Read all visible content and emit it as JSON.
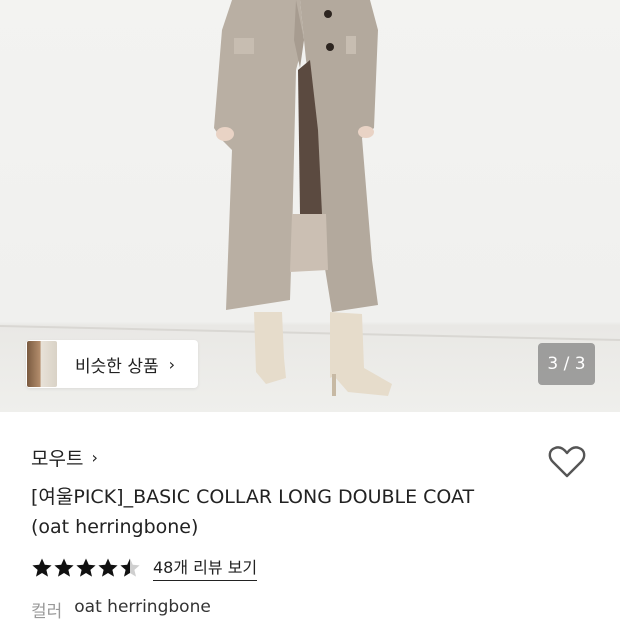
{
  "hero": {
    "similar_products_label": "비슷한 상품",
    "similar_chevron": "›",
    "image_counter": "3 / 3"
  },
  "product": {
    "brand": "모우트",
    "brand_chevron": "›",
    "title_line1": "[여울PICK]_BASIC COLLAR LONG DOUBLE COAT",
    "title_line2": "(oat herringbone)",
    "rating": 4.5,
    "review_link": "48개 리뷰 보기",
    "option_label": "컬러",
    "option_value": "oat herringbone"
  },
  "colors": {
    "coat": "#b8aea2",
    "boots": "#e6dccb",
    "star": "#111111",
    "star_empty": "#cfcfcf"
  },
  "icons": {
    "wishlist": "heart-outline-icon",
    "chevron": "chevron-right-icon",
    "star": "star-icon"
  }
}
